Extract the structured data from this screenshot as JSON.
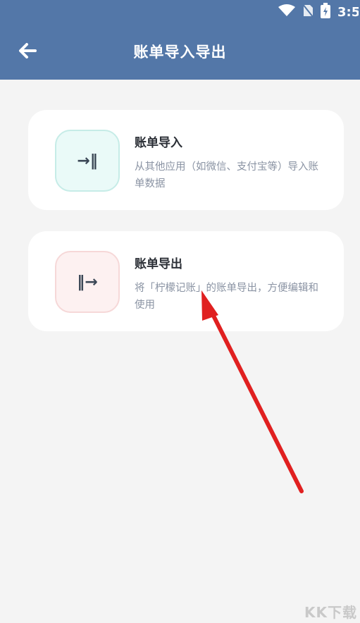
{
  "header": {
    "title": "账单导入导出",
    "background_color": "#5377a8",
    "back_icon": "arrow-left-icon"
  },
  "status_bar": {
    "time": "3:5",
    "icons": [
      "wifi-icon",
      "no-sim-icon",
      "battery-icon"
    ]
  },
  "cards": {
    "import": {
      "title": "账单导入",
      "description": "从其他应用（如微信、支付宝等）导入账单数据",
      "icon_glyph": "→‖",
      "icon": "import-icon",
      "icon_bg_color": "#eafaf8"
    },
    "export": {
      "title": "账单导出",
      "description": "将「柠檬记账」的账单导出，方便编辑和使用",
      "icon_glyph": "‖→",
      "icon": "export-icon",
      "icon_bg_color": "#fdf1f1"
    }
  },
  "annotation": {
    "arrow_color": "#e02020"
  },
  "watermark": {
    "text": "KK下载"
  }
}
